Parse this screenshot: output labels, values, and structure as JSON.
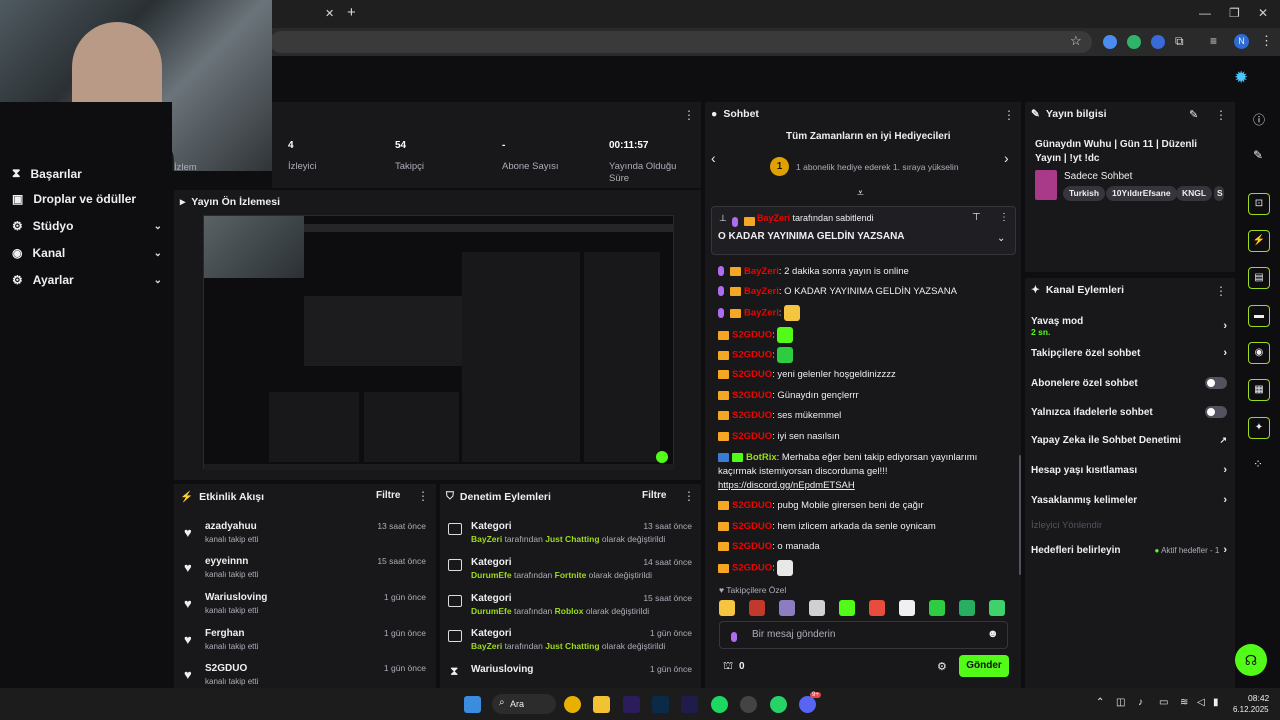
{
  "browser": {
    "new_tab": "+",
    "close_tab": "✕"
  },
  "sidebar": {
    "items": [
      {
        "label": "Başarılar"
      },
      {
        "label": "Droplar ve ödüller"
      },
      {
        "label": "Stüdyo"
      },
      {
        "label": "Kanal"
      },
      {
        "label": "Ayarlar"
      }
    ]
  },
  "stats": [
    {
      "value": "4",
      "label": "İzleyici"
    },
    {
      "value": "54",
      "label": "Takipçi"
    },
    {
      "value": "-",
      "label": "Abone Sayısı"
    },
    {
      "value": "00:11:57",
      "label": "Yayında Olduğu Süre"
    }
  ],
  "stats_partial_label": "İzlem",
  "preview": {
    "title": "Yayın Ön İzlemesi"
  },
  "activity": {
    "title": "Etkinlik Akışı",
    "filter": "Filtre",
    "items": [
      {
        "name": "azadyahuu",
        "sub": "kanalı takip etti",
        "time": "13 saat önce"
      },
      {
        "name": "eyyeinnn",
        "sub": "kanalı takip etti",
        "time": "15 saat önce"
      },
      {
        "name": "Wariusloving",
        "sub": "kanalı takip etti",
        "time": "1 gün önce"
      },
      {
        "name": "Ferghan",
        "sub": "kanalı takip etti",
        "time": "1 gün önce"
      },
      {
        "name": "S2GDUO",
        "sub": "kanalı takip etti",
        "time": "1 gün önce"
      }
    ]
  },
  "moderation": {
    "title": "Denetim Eylemleri",
    "filter": "Filtre",
    "items": [
      {
        "title": "Kategori",
        "user": "BayZeri",
        "mid": "tarafından",
        "value": "Just Chatting",
        "end": "olarak değiştirildi",
        "time": "13 saat önce"
      },
      {
        "title": "Kategori",
        "user": "DurumEfe",
        "mid": "tarafından",
        "value": "Fortnite",
        "end": "olarak değiştirildi",
        "time": "14 saat önce"
      },
      {
        "title": "Kategori",
        "user": "DurumEfe",
        "mid": "tarafından",
        "value": "Roblox",
        "end": "olarak değiştirildi",
        "time": "15 saat önce"
      },
      {
        "title": "Kategori",
        "user": "BayZeri",
        "mid": "tarafından",
        "value": "Just Chatting",
        "end": "olarak değiştirildi",
        "time": "1 gün önce"
      },
      {
        "title": "Wariusloving",
        "user": "",
        "mid": "",
        "value": "",
        "end": "",
        "time": "1 gün önce"
      }
    ]
  },
  "chat": {
    "title": "Sohbet",
    "gifters_title": "Tüm Zamanların en iyi Hediyecileri",
    "gifters_rank": "1",
    "gifters_text": "1 abonelik hediye ederek 1. sıraya yükselin",
    "pinned_by": "BayZeri",
    "pinned_suffix": "tarafından sabitlendi",
    "pinned_text": "O KADAR YAYINIMA GELDİN YAZSANA",
    "messages": [
      {
        "user": "BayZeri",
        "text": ": 2 dakika sonra yayın is online"
      },
      {
        "user": "BayZeri",
        "text": ": O KADAR YAYINIMA GELDİN YAZSANA"
      },
      {
        "user": "BayZeri",
        "text": ":"
      },
      {
        "user": "S2GDUO",
        "text": ":"
      },
      {
        "user": "S2GDUO",
        "text": ":"
      },
      {
        "user": "S2GDUO",
        "text": ": yeni gelenler hoşgeldinizzzz"
      },
      {
        "user": "S2GDUO",
        "text": ": Günaydın gençlerrr"
      },
      {
        "user": "S2GDUO",
        "text": ": ses mükemmel"
      },
      {
        "user": "S2GDUO",
        "text": ": iyi sen nasılsın"
      },
      {
        "user": "BotRix",
        "text": ": Merhaba eğer beni takip ediyorsan yayınlarımı kaçırmak istemiyorsan discorduma gel!!!",
        "link": "https://discord.gg/nEpdmETSAH"
      },
      {
        "user": "S2GDUO",
        "text": ": pubg Mobile girersen beni de çağır"
      },
      {
        "user": "S2GDUO",
        "text": ": hem izlicem arkada da senle oynicam"
      },
      {
        "user": "S2GDUO",
        "text": ": o manada"
      },
      {
        "user": "S2GDUO",
        "text": ":"
      }
    ],
    "followers_only": "Takipçilere Özel",
    "input_placeholder": "Bir mesaj gönderin",
    "points": "0",
    "send": "Gönder"
  },
  "stream_info": {
    "title": "Yayın bilgisi",
    "stream_title": "Günaydın Wuhu | Gün 11 | Düzenli Yayın | !yt !dc",
    "category": "Sadece Sohbet",
    "tags": [
      "Turkish",
      "10YıldırEfsane",
      "KNGL",
      "S"
    ]
  },
  "channel_actions": {
    "title": "Kanal Eylemleri",
    "slow_mode": "Yavaş mod",
    "slow_mode_value": "2 sn.",
    "rows": [
      "Takipçilere özel sohbet",
      "Abonelere özel sohbet",
      "Yalnızca ifadelerle sohbet",
      "Yapay Zeka ile Sohbet Denetimi",
      "Hesap yaşı kısıtlaması",
      "Yasaklanmış kelimeler"
    ],
    "host_label": "İzleyici Yönlendir",
    "goals_label": "Hedefleri belirleyin",
    "goals_status": "Aktif hedefler - 1"
  },
  "taskbar": {
    "search": "Ara",
    "clock_time": "08:42",
    "clock_date": "6.12.2025",
    "discord_badge": "9+"
  },
  "colors": {
    "accent": "#53fc18",
    "brand_green": "#9ddb1c",
    "panel": "#18181b",
    "bg": "#0e0e10",
    "name_red": "#eb0400"
  }
}
